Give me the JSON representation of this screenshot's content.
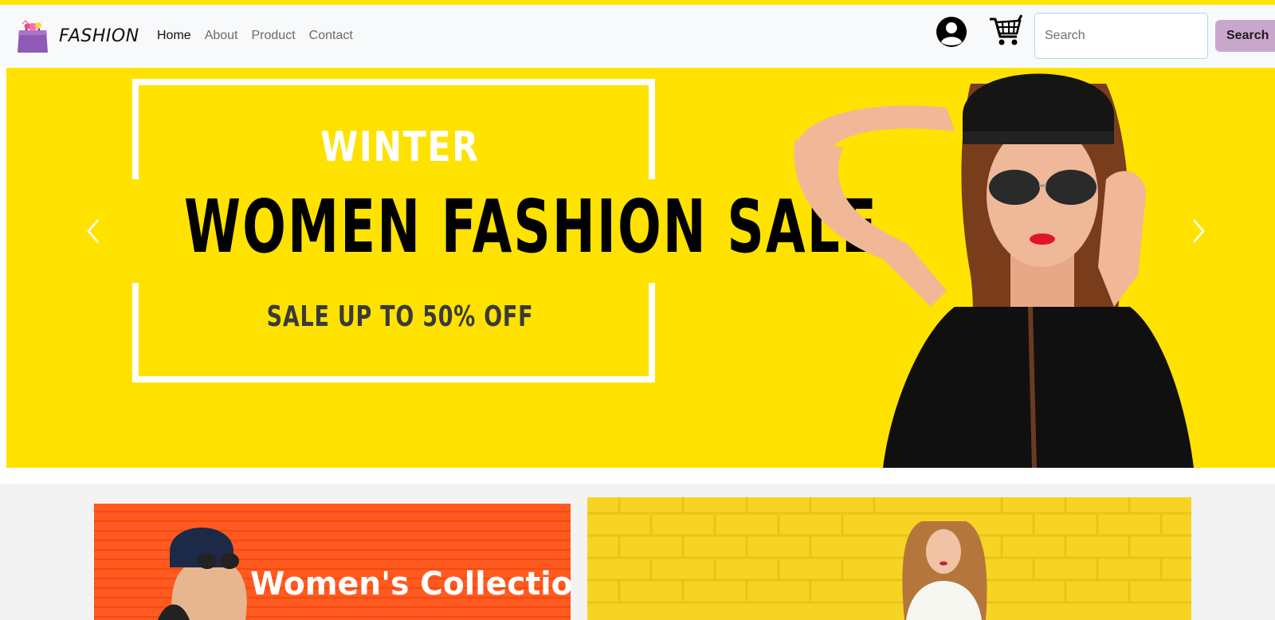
{
  "colors": {
    "accent_yellow": "#ffe200",
    "search_button": "#c9a7cc",
    "women_card": "#ff5a1f",
    "brick_card": "#f7d424"
  },
  "brand": {
    "name": "FASHION",
    "logo_icon": "shopping-bag-icon"
  },
  "nav": {
    "links": [
      {
        "label": "Home",
        "active": true
      },
      {
        "label": "About",
        "active": false
      },
      {
        "label": "Product",
        "active": false
      },
      {
        "label": "Contact",
        "active": false
      }
    ]
  },
  "header_icons": {
    "account": "user-account-icon",
    "cart": "shopping-cart-icon"
  },
  "search": {
    "placeholder": "Search",
    "value": "",
    "button_label": "Search"
  },
  "hero": {
    "season": "WINTER",
    "headline": "WOMEN FASHION SALE",
    "subline": "SALE UP TO 50% OFF",
    "prev_icon": "chevron-left-icon",
    "next_icon": "chevron-right-icon"
  },
  "cards": {
    "women_title": "Women's Collection"
  }
}
